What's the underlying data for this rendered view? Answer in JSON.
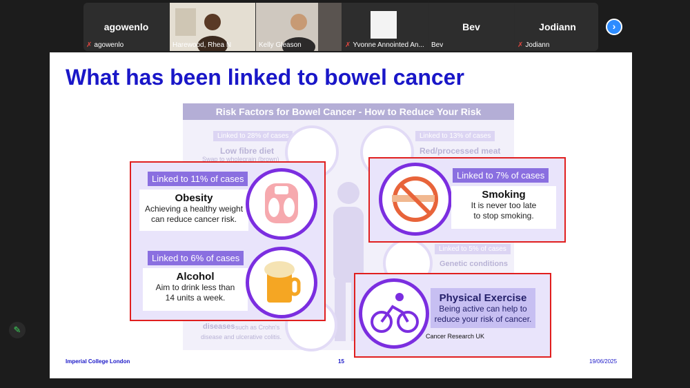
{
  "participants": [
    {
      "display": "agowenlo",
      "label": "agowenlo",
      "muted": true
    },
    {
      "display": "",
      "label": "Harewood, Rhea N",
      "muted": false
    },
    {
      "display": "",
      "label": "Kelly Gleason",
      "muted": false
    },
    {
      "display": "",
      "label": "Yvonne Annointed An...",
      "muted": true
    },
    {
      "display": "Bev",
      "label": "Bev",
      "muted": false
    },
    {
      "display": "Jodiann",
      "label": "Jodiann",
      "muted": true
    }
  ],
  "icons": {
    "mute": "microphone-muted-icon",
    "next": "chevron-right-icon",
    "annotate": "pencil-icon"
  },
  "colors": {
    "title": "#1a17c8",
    "accent": "#7b2ee0",
    "highlight": "#e01e1e",
    "speaking": "#3ed35b"
  },
  "slide": {
    "title": "What has been linked to bowel cancer",
    "infographic_title": "Risk Factors for Bowel Cancer - How to Reduce Your Risk",
    "bg_items": {
      "fibre_pill": "Linked to 28% of cases",
      "fibre_head": "Low fibre diet",
      "fibre_sub": "Swap to wholegrain (brown)",
      "meat_pill": "Linked to 13% of cases",
      "meat_head": "Red/processed meat",
      "genetic_pill": "Linked to 5% of cases",
      "genetic_head": "Genetic conditions",
      "disease_head": "diseases",
      "disease_sub1": "such as Crohn's",
      "disease_sub2": "disease and ulcerative colitis."
    },
    "obesity": {
      "pill": "Linked to 11% of cases",
      "head": "Obesity",
      "line1": "Achieving a healthy weight",
      "line2": "can reduce cancer risk."
    },
    "alcohol": {
      "pill": "Linked to 6% of cases",
      "head": "Alcohol",
      "line1": "Aim to drink less than",
      "line2": "14 units a week."
    },
    "smoking": {
      "pill": "Linked to 7% of cases",
      "head": "Smoking",
      "line1": "It is never too late",
      "line2": "to stop smoking."
    },
    "exercise": {
      "head": "Physical Exercise",
      "line1": "Being active can help to",
      "line2": "reduce your risk of cancer.",
      "source": "Cancer Research UK"
    },
    "footer_left": "Imperial College London",
    "footer_page": "15",
    "footer_date": "19/06/2025"
  }
}
